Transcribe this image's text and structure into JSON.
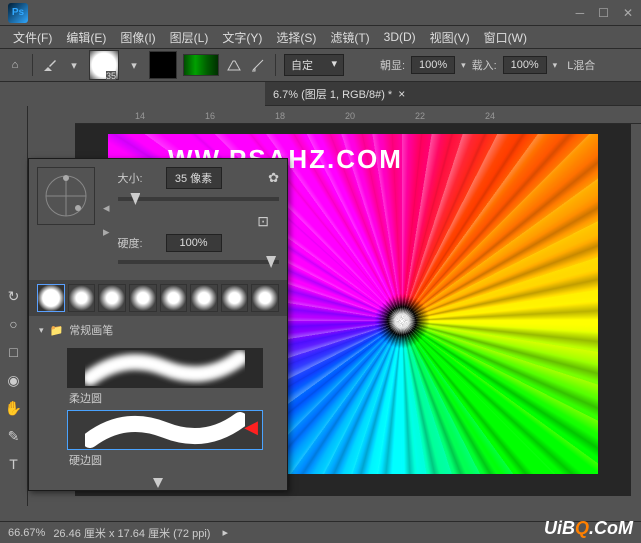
{
  "app": {
    "logo": "Ps"
  },
  "menu": {
    "file": "文件(F)",
    "edit": "编辑(E)",
    "image": "图像(I)",
    "layer": "图层(L)",
    "type": "文字(Y)",
    "select": "选择(S)",
    "filter": "滤镜(T)",
    "threeD": "3D(D)",
    "view": "视图(V)",
    "window": "窗口(W)"
  },
  "toolbar": {
    "brush_num": "35",
    "mode_label": "自定",
    "opacity_label": "朝显:",
    "opacity_value": "100%",
    "flow_label": "载入:",
    "flow_value": "100%",
    "blend": "L混合"
  },
  "doc_tab": "6.7% (图层 1, RGB/8#) *",
  "ruler": {
    "t1": "14",
    "t2": "16",
    "t3": "18",
    "t4": "20",
    "t5": "22",
    "t6": "24"
  },
  "watermark": "WW.PSAHZ.COM",
  "brush_panel": {
    "size_label": "大小:",
    "size_value": "35 像素",
    "hardness_label": "硬度:",
    "hardness_value": "100%",
    "folder_label": "常规画笔",
    "brush1": "柔边圆",
    "brush2": "硬边圆"
  },
  "status": {
    "zoom": "66.67%",
    "dims": "26.46 厘米 x 17.64 厘米 (72 ppi)"
  },
  "uibq": {
    "pre": "UiB",
    "mid": "Q",
    "post": ".CoM"
  }
}
